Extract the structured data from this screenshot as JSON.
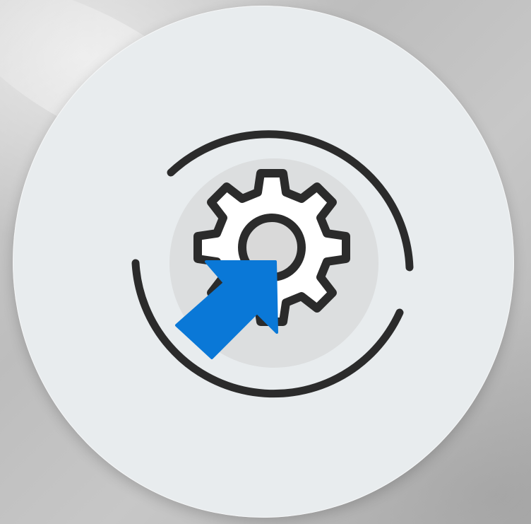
{
  "icon": {
    "name": "settings-update-icon",
    "parts": [
      "refresh-arc-icon",
      "gear-icon",
      "arrow-icon"
    ]
  },
  "colors": {
    "background": "#c4c4c4",
    "badge": "#e8ecee",
    "outline": "#2b2b2b",
    "gear_fill": "#ffffff",
    "hub_fill": "#d9d9d9",
    "halo": "#dcdedf",
    "arrow": "#0a78d7"
  }
}
